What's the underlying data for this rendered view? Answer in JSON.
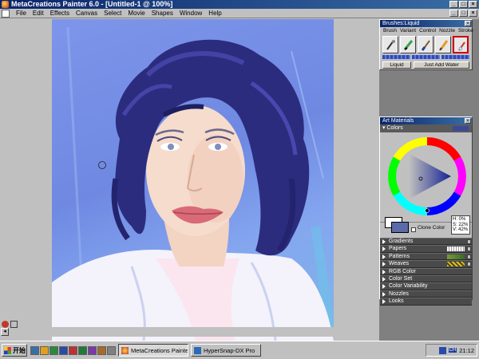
{
  "window": {
    "title": "MetaCreations Painter 6.0 - [Untitled-1 @ 100%]",
    "controls": [
      "_",
      "□",
      "×"
    ]
  },
  "menu": [
    "File",
    "Edit",
    "Effects",
    "Canvas",
    "Select",
    "Movie",
    "Shapes",
    "Window",
    "Help"
  ],
  "brushes_palette": {
    "title": "Brushes:Liquid",
    "menu": [
      "Brush",
      "Variant",
      "Control",
      "Nozzle",
      "Stroke"
    ],
    "brush_category": "Liquid",
    "brush_variant": "Just Add Water",
    "icons": [
      "airbrush-icon",
      "crayon-icon",
      "brush-icon",
      "pencil-icon",
      "liquid-brush-icon"
    ]
  },
  "art_materials": {
    "title": "Art Materials",
    "colors_label": "Colors",
    "hsv": {
      "h": "H: 0%",
      "s": "S: 22%",
      "v": "V: 42%"
    },
    "clone_color_label": "Clone Color",
    "primary_color": "#ffffff",
    "secondary_color": "#5b6aa8",
    "sections": [
      "Gradients",
      "Papers",
      "Patterns",
      "Weaves",
      "RGB Color",
      "Color Set",
      "Color Variability",
      "Nozzles",
      "Looks"
    ]
  },
  "taskbar": {
    "start_label": "开始",
    "tasks": [
      {
        "label": "MetaCreations Painter 6....",
        "active": true
      },
      {
        "label": "HyperSnap-DX Pro",
        "active": false
      }
    ],
    "clock": "21:12",
    "tray_lang": "CH"
  }
}
